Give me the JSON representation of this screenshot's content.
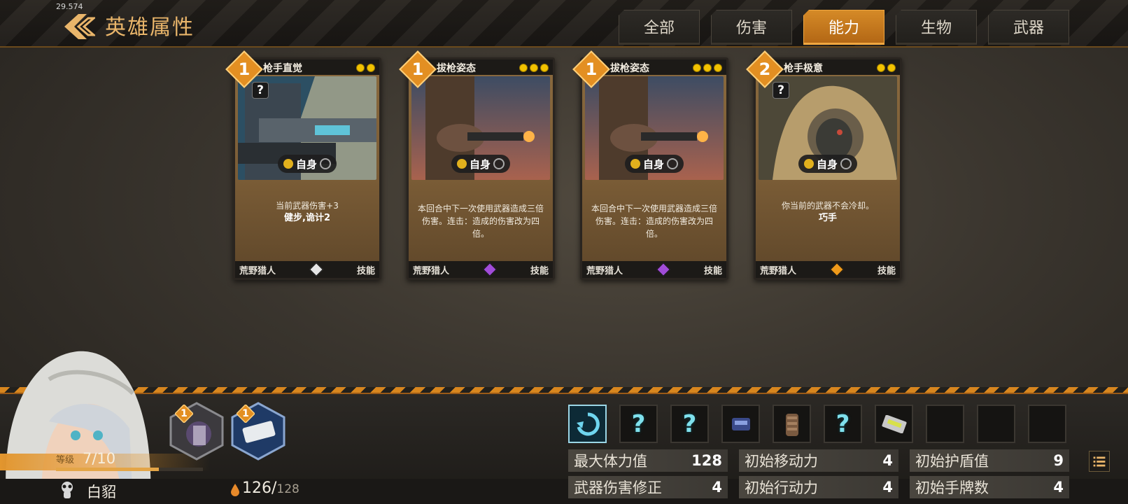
{
  "fps": "29.574",
  "header": {
    "title": "英雄属性"
  },
  "tabs": [
    {
      "label": "全部"
    },
    {
      "label": "伤害"
    },
    {
      "label": "能力"
    },
    {
      "label": "生物"
    },
    {
      "label": "武器"
    }
  ],
  "active_tab": "能力",
  "cards": [
    {
      "cost": "1",
      "name": "枪手直觉",
      "dots": 2,
      "target": "自身",
      "desc": "当前武器伤害+3",
      "keyword": "健步,诡计2",
      "hero": "荒野猎人",
      "type": "技能",
      "gem_color": "#e6e6e6",
      "art": "gunner-robot"
    },
    {
      "cost": "1",
      "name": "拔枪姿态",
      "dots": 3,
      "target": "自身",
      "desc": "本回合中下一次使用武器造成三倍伤害。连击：造成的伤害改为四倍。",
      "keyword": "",
      "hero": "荒野猎人",
      "type": "技能",
      "gem_color": "#a14cd8",
      "art": "revolver-shot"
    },
    {
      "cost": "1",
      "name": "拔枪姿态",
      "dots": 3,
      "target": "自身",
      "desc": "本回合中下一次使用武器造成三倍伤害。连击：造成的伤害改为四倍。",
      "keyword": "",
      "hero": "荒野猎人",
      "type": "技能",
      "gem_color": "#a14cd8",
      "art": "revolver-shot"
    },
    {
      "cost": "2",
      "name": "枪手极意",
      "dots": 2,
      "target": "自身",
      "desc": "你当前的武器不会冷却。",
      "keyword": "巧手",
      "hero": "荒野猎人",
      "type": "技能",
      "gem_color": "#f09a1a",
      "art": "hooded-sniper"
    }
  ],
  "hero": {
    "name": "白貂",
    "level_label": "等级",
    "level": "7/10",
    "level_progress": 0.7,
    "hp_current": "126",
    "hp_max": "128"
  },
  "equipment": [
    {
      "cost": "1",
      "icon": "creature-equip-icon"
    },
    {
      "cost": "1",
      "icon": "armor-plate-equip-icon"
    }
  ],
  "skill_slots": [
    {
      "icon": "refresh-icon",
      "text": "",
      "selected": true
    },
    {
      "icon": "unknown-icon",
      "text": "?"
    },
    {
      "icon": "unknown-icon",
      "text": "?"
    },
    {
      "icon": "gadget-icon",
      "text": ""
    },
    {
      "icon": "grenade-icon",
      "text": ""
    },
    {
      "icon": "unknown-icon",
      "text": "?"
    },
    {
      "icon": "chip-icon",
      "text": ""
    },
    {
      "icon": "empty-slot",
      "text": ""
    },
    {
      "icon": "empty-slot",
      "text": ""
    },
    {
      "icon": "empty-slot",
      "text": ""
    }
  ],
  "stats": [
    {
      "label": "最大体力值",
      "value": "128"
    },
    {
      "label": "初始移动力",
      "value": "4"
    },
    {
      "label": "初始护盾值",
      "value": "9"
    },
    {
      "label": "武器伤害修正",
      "value": "4"
    },
    {
      "label": "初始行动力",
      "value": "4"
    },
    {
      "label": "初始手牌数",
      "value": "4"
    }
  ],
  "colors": {
    "accent": "#e38f22",
    "title": "#e9b56a",
    "cyan": "#7fe0ec"
  }
}
